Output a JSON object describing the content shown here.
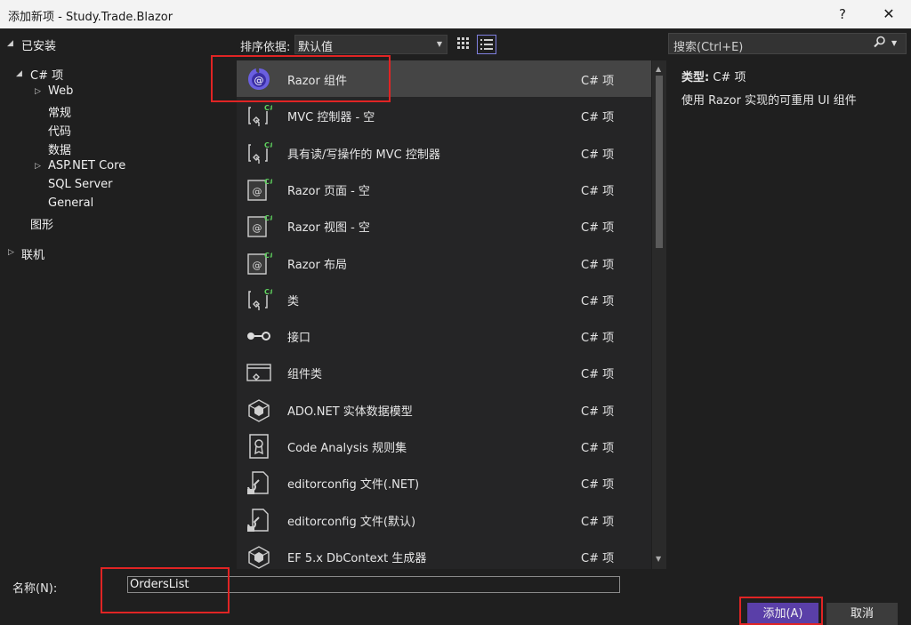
{
  "window": {
    "title": "添加新项 - Study.Trade.Blazor",
    "help_glyph": "?",
    "close_glyph": "✕"
  },
  "tree": {
    "installed": "已安装",
    "csharp": "C# 项",
    "web": "Web",
    "general_cn": "常规",
    "code": "代码",
    "data": "数据",
    "aspnet": "ASP.NET Core",
    "sql": "SQL Server",
    "general": "General",
    "graphics": "图形",
    "online": "联机"
  },
  "sort": {
    "label": "排序依据:",
    "value": "默认值"
  },
  "search": {
    "placeholder": "搜索(Ctrl+E)"
  },
  "templates": [
    {
      "name": "Razor 组件",
      "lang": "C# 项",
      "icon": "razor-component-icon"
    },
    {
      "name": "MVC 控制器 - 空",
      "lang": "C# 项",
      "icon": "csharp-class-icon"
    },
    {
      "name": "具有读/写操作的 MVC 控制器",
      "lang": "C# 项",
      "icon": "csharp-class-icon"
    },
    {
      "name": "Razor 页面 - 空",
      "lang": "C# 项",
      "icon": "razor-page-icon"
    },
    {
      "name": "Razor 视图 - 空",
      "lang": "C# 项",
      "icon": "razor-page-icon"
    },
    {
      "name": "Razor 布局",
      "lang": "C# 项",
      "icon": "razor-page-icon"
    },
    {
      "name": "类",
      "lang": "C# 项",
      "icon": "csharp-class-icon"
    },
    {
      "name": "接口",
      "lang": "C# 项",
      "icon": "interface-icon"
    },
    {
      "name": "组件类",
      "lang": "C# 项",
      "icon": "component-class-icon"
    },
    {
      "name": "ADO.NET 实体数据模型",
      "lang": "C# 项",
      "icon": "entity-model-icon"
    },
    {
      "name": "Code Analysis 规则集",
      "lang": "C# 项",
      "icon": "ruleset-icon"
    },
    {
      "name": "editorconfig 文件(.NET)",
      "lang": "C# 项",
      "icon": "editorconfig-icon"
    },
    {
      "name": "editorconfig 文件(默认)",
      "lang": "C# 项",
      "icon": "editorconfig-icon"
    },
    {
      "name": "EF 5.x DbContext 生成器",
      "lang": "C# 项",
      "icon": "entity-model-icon"
    }
  ],
  "info": {
    "type_label": "类型:",
    "type_value": "C# 项",
    "description": "使用 Razor 实现的可重用 UI 组件"
  },
  "bottom": {
    "name_label": "名称(N):",
    "name_value": "OrdersList",
    "add": "添加(A)",
    "cancel": "取消"
  },
  "colors": {
    "accent": "#5a3fa8",
    "highlight": "#e02424",
    "csharp_badge": "#5fd35f"
  }
}
